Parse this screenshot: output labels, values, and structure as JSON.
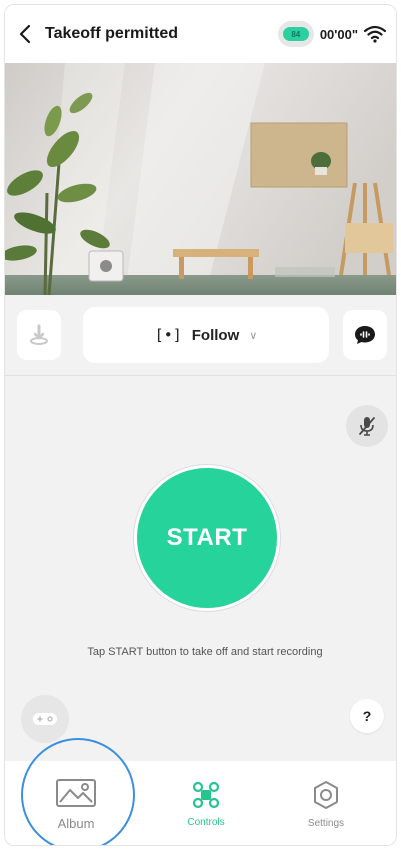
{
  "header": {
    "title": "Takeoff permitted",
    "battery_label": "84",
    "timer": "00'00\""
  },
  "controls": {
    "follow_bracket": "[•]",
    "follow_label": "Follow",
    "follow_chevron": "∨"
  },
  "main": {
    "start_label": "START",
    "hint": "Tap START button to take off and start recording",
    "help_label": "?"
  },
  "tabs": [
    {
      "label": "Album",
      "icon": "image-icon",
      "active": false
    },
    {
      "label": "Controls",
      "icon": "drone-icon",
      "active": true
    },
    {
      "label": "Settings",
      "icon": "hexagon-settings-icon",
      "active": false
    }
  ],
  "colors": {
    "accent": "#26d39a",
    "highlight_ring": "#3b8fe0"
  }
}
